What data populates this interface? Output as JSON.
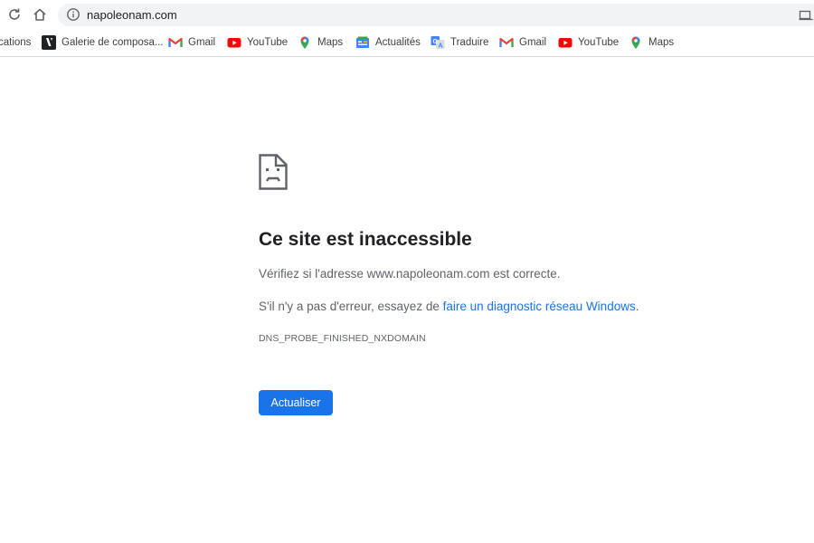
{
  "toolbar": {
    "url": "napoleonam.com"
  },
  "bookmarks": [
    {
      "label": "cations",
      "icon": "apps-icon"
    },
    {
      "label": "Galerie de composa...",
      "icon": "galerie-icon"
    },
    {
      "label": "Gmail",
      "icon": "gmail-icon"
    },
    {
      "label": "YouTube",
      "icon": "youtube-icon"
    },
    {
      "label": "Maps",
      "icon": "maps-icon"
    },
    {
      "label": "Actualités",
      "icon": "news-icon"
    },
    {
      "label": "Traduire",
      "icon": "translate-icon"
    },
    {
      "label": "Gmail",
      "icon": "gmail-icon"
    },
    {
      "label": "YouTube",
      "icon": "youtube-icon"
    },
    {
      "label": "Maps",
      "icon": "maps-icon"
    }
  ],
  "error": {
    "title": "Ce site est inaccessible",
    "check_text": "Vérifiez si l'adresse www.napoleonam.com est correcte.",
    "suggest_prefix": "S'il n'y a pas d'erreur, essayez de ",
    "suggest_link": "faire un diagnostic réseau Windows",
    "suggest_suffix": ".",
    "code": "DNS_PROBE_FINISHED_NXDOMAIN",
    "button": "Actualiser"
  },
  "colors": {
    "accent": "#1a73e8",
    "text_primary": "#202124",
    "text_secondary": "#5f6368",
    "omnibox_bg": "#f1f3f4"
  }
}
